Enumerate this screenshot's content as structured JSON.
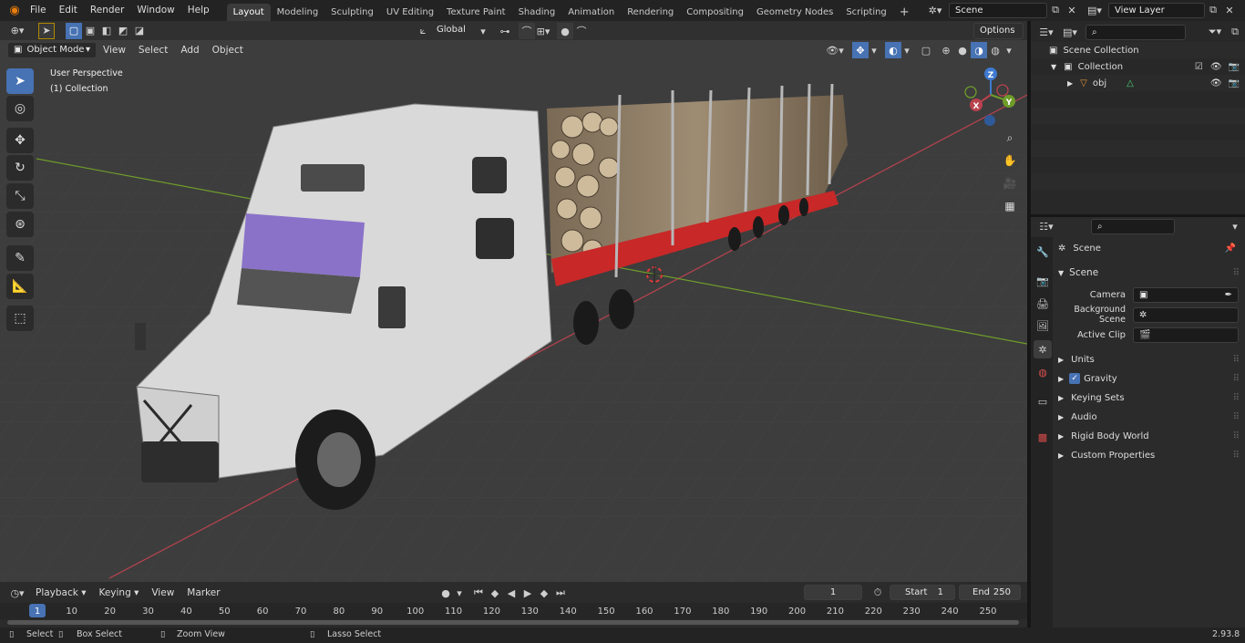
{
  "topbar": {
    "menus": [
      "File",
      "Edit",
      "Render",
      "Window",
      "Help"
    ],
    "workspaces": [
      "Layout",
      "Modeling",
      "Sculpting",
      "UV Editing",
      "Texture Paint",
      "Shading",
      "Animation",
      "Rendering",
      "Compositing",
      "Geometry Nodes",
      "Scripting"
    ],
    "active_workspace": "Layout",
    "add_tab_glyph": "+",
    "scene_name": "Scene",
    "view_layer_name": "View Layer"
  },
  "viewport_header": {
    "mode": "Object Mode",
    "menus": [
      "View",
      "Select",
      "Add",
      "Object"
    ],
    "transform_orientation": "Global",
    "options_label": "Options"
  },
  "viewport": {
    "perspective_label": "User Perspective",
    "collection_label": "(1) Collection",
    "gizmo_axes": {
      "x": "X",
      "y": "Y",
      "z": "Z"
    },
    "colors": {
      "x_axis": "#b9424e",
      "y_axis": "#6f9c2a",
      "z_axis": "#3f7ad0",
      "grid_bg": "#3d3d3d",
      "truck_white": "#dcdcdc",
      "trailer_red": "#c82828",
      "visor_purple": "#8a72c9"
    }
  },
  "outliner": {
    "root": "Scene Collection",
    "collection": "Collection",
    "object": "obj"
  },
  "properties": {
    "header": "Scene",
    "section": "Scene",
    "fields": [
      {
        "label": "Camera",
        "value": ""
      },
      {
        "label": "Background Scene",
        "value": ""
      },
      {
        "label": "Active Clip",
        "value": ""
      }
    ],
    "panels": [
      "Units",
      "Gravity",
      "Keying Sets",
      "Audio",
      "Rigid Body World",
      "Custom Properties"
    ],
    "gravity_checked": true
  },
  "timeline": {
    "menus": [
      "Playback",
      "Keying",
      "View",
      "Marker"
    ],
    "current_frame": "1",
    "start_label": "Start",
    "start_value": "1",
    "end_label": "End",
    "end_value": "250",
    "ticks": [
      "1",
      "10",
      "20",
      "30",
      "40",
      "50",
      "60",
      "70",
      "80",
      "90",
      "100",
      "110",
      "120",
      "130",
      "140",
      "150",
      "160",
      "170",
      "180",
      "190",
      "200",
      "210",
      "220",
      "230",
      "240",
      "250"
    ]
  },
  "statusbar": {
    "select": "Select",
    "box_select": "Box Select",
    "zoom_view": "Zoom View",
    "lasso_select": "Lasso Select",
    "version": "2.93.8"
  }
}
